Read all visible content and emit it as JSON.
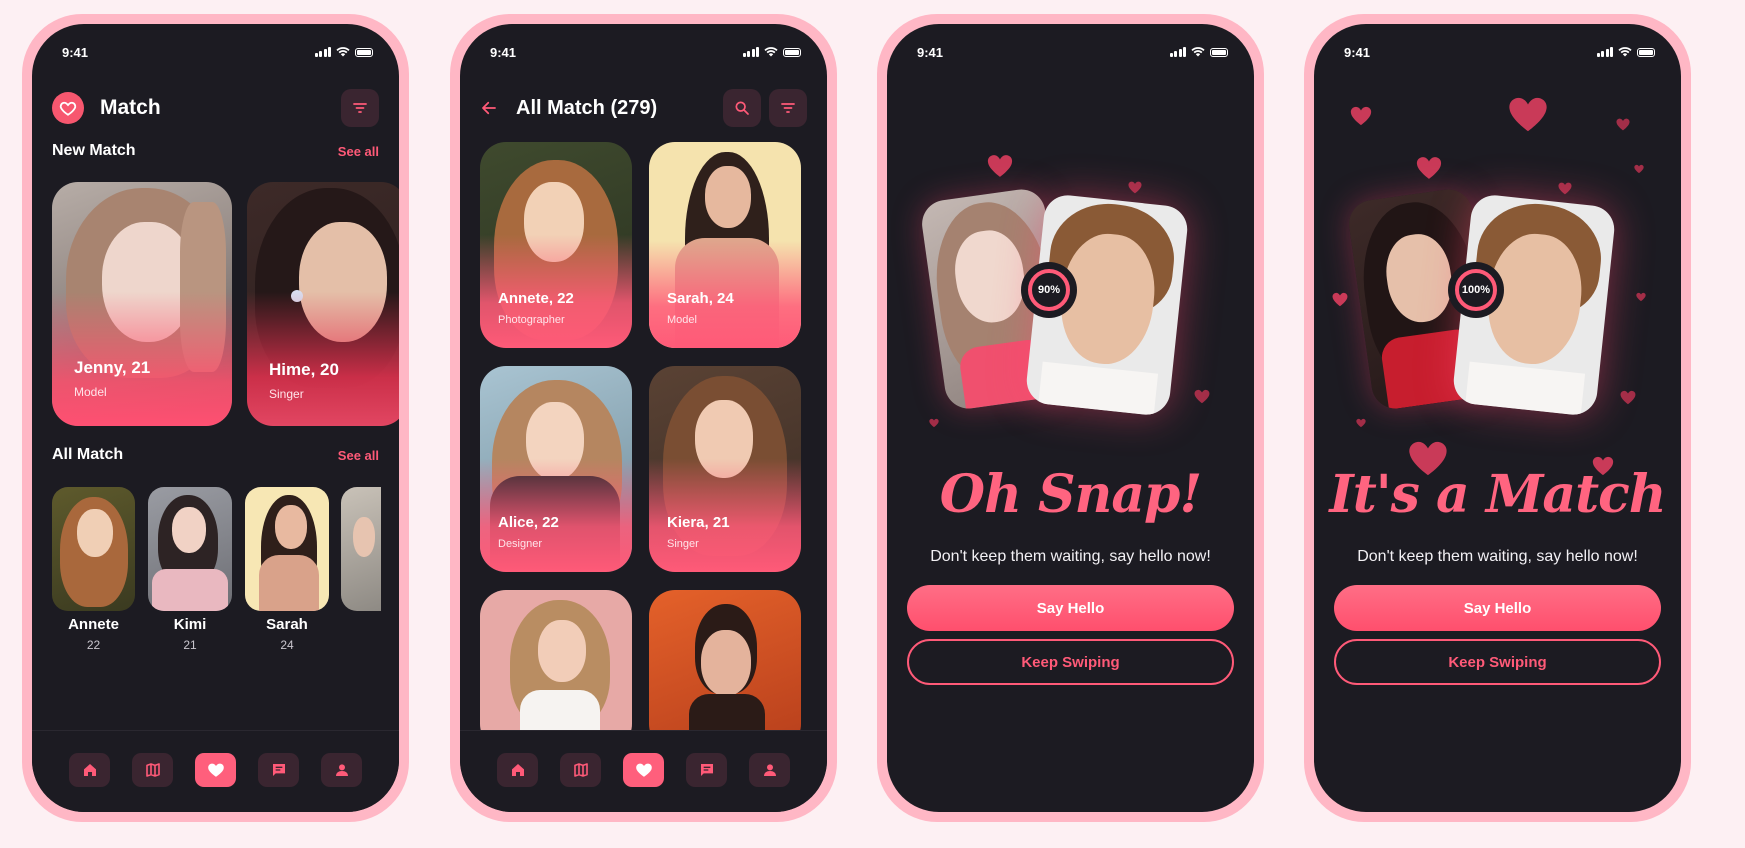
{
  "status_time": "9:41",
  "screen1": {
    "title": "Match",
    "new_match_heading": "New Match",
    "new_match_see_all": "See all",
    "new_match_cards": [
      {
        "name": "Jenny, 21",
        "role": "Model"
      },
      {
        "name": "Hime, 20",
        "role": "Singer"
      }
    ],
    "all_match_heading": "All Match",
    "all_match_see_all": "See all",
    "all_match_people": [
      {
        "name": "Annete",
        "age": "22"
      },
      {
        "name": "Kimi",
        "age": "21"
      },
      {
        "name": "Sarah",
        "age": "24"
      }
    ]
  },
  "screen2": {
    "title": "All Match (279)",
    "cards": [
      {
        "name": "Annete, 22",
        "role": "Photographer"
      },
      {
        "name": "Sarah, 24",
        "role": "Model"
      },
      {
        "name": "Alice, 22",
        "role": "Designer"
      },
      {
        "name": "Kiera, 21",
        "role": "Singer"
      }
    ]
  },
  "screen3": {
    "percent": "90%",
    "headline": "Oh Snap!",
    "tagline": "Don't keep them waiting, say hello now!",
    "primary_button": "Say Hello",
    "secondary_button": "Keep Swiping"
  },
  "screen4": {
    "percent": "100%",
    "headline": "It's a Match",
    "tagline": "Don't keep them waiting, say hello now!",
    "primary_button": "Say Hello",
    "secondary_button": "Keep Swiping"
  },
  "nav_items": [
    "home-icon",
    "map-icon",
    "heart-icon",
    "chat-icon",
    "profile-icon"
  ],
  "colors": {
    "accent": "#FF5A78",
    "phone_frame": "#FFB7C5",
    "screen_bg": "#1C1B22",
    "page_bg": "#FDF0F3"
  }
}
